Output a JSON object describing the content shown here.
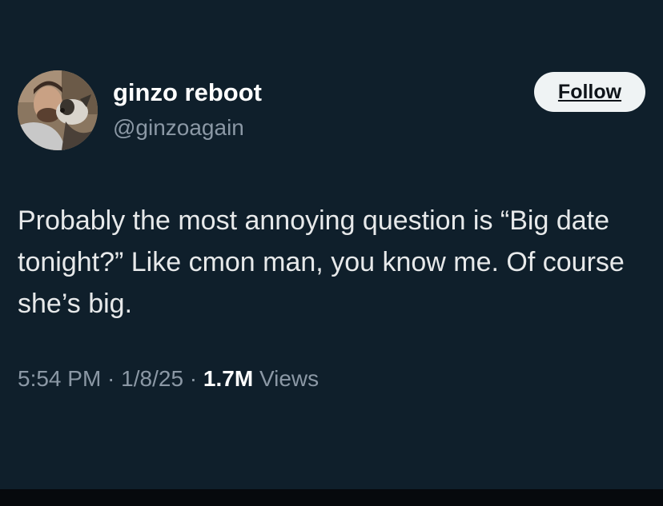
{
  "author": {
    "display_name": "ginzo reboot",
    "handle": "@ginzoagain"
  },
  "actions": {
    "follow_label": "Follow"
  },
  "tweet": {
    "text": "Probably the most annoying question is “Big date tonight?” Like cmon man, you know me. Of course she’s big."
  },
  "meta": {
    "time": "5:54 PM",
    "separator": " · ",
    "date": "1/8/25",
    "views_count": "1.7M",
    "views_label": " Views"
  },
  "colors": {
    "background": "#0f1f2b",
    "primary_text": "#e7e9ea",
    "secondary_text": "#8b98a5",
    "follow_bg": "#eff3f4"
  },
  "icons": {
    "avatar": "profile-photo-man-with-dog"
  }
}
